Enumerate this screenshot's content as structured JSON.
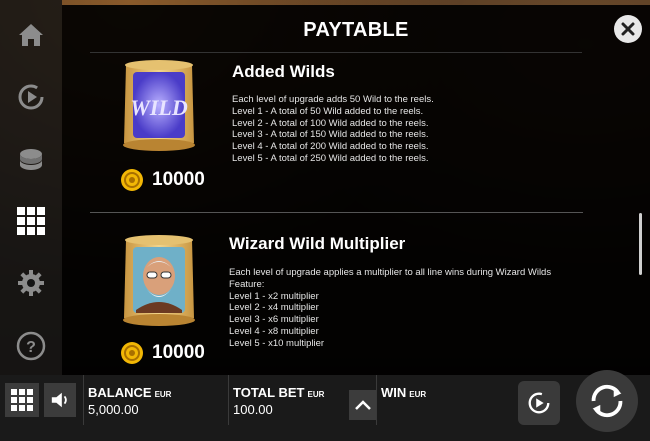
{
  "paytable": {
    "title": "PAYTABLE",
    "sections": [
      {
        "title": "Added Wilds",
        "cost": "10000",
        "scroll_text": "WILD",
        "description": [
          "Each level of upgrade adds 50 Wild to the reels.",
          "Level 1 - A total of 50 Wild added to the reels.",
          "Level 2 - A total of 100 Wild added to the reels.",
          "Level 3 - A total of 150 Wild added to the reels.",
          "Level 4 - A total of 200 Wild added to the reels.",
          "Level 5 - A total of 250 Wild added to the reels."
        ]
      },
      {
        "title": "Wizard Wild Multiplier",
        "cost": "10000",
        "description": [
          "Each level of upgrade applies a multiplier to all line wins during Wizard Wilds",
          "Feature:",
          "Level 1 - x2 multiplier",
          "Level 2 - x4 multiplier",
          "Level 3 - x6 multiplier",
          "Level 4 - x8 multiplier",
          "Level 5 - x10 multiplier"
        ]
      }
    ]
  },
  "nav": {
    "items": [
      "home-icon",
      "replay-icon",
      "coins-icon",
      "paytable-grid-icon",
      "settings-gear-icon",
      "help-icon"
    ],
    "active": "paytable-grid-icon"
  },
  "bottom_bar": {
    "balance": {
      "label": "BALANCE",
      "unit": "EUR",
      "value": "5,000.00"
    },
    "total_bet": {
      "label": "TOTAL BET",
      "unit": "EUR",
      "value": "100.00"
    },
    "win": {
      "label": "WIN",
      "unit": "EUR",
      "value": ""
    }
  },
  "colors": {
    "panel_bg": "#000000",
    "coin_gold": "#f2b705",
    "scroll_parchment": "#e8c77a",
    "wild_glow": "#7b6cff"
  }
}
